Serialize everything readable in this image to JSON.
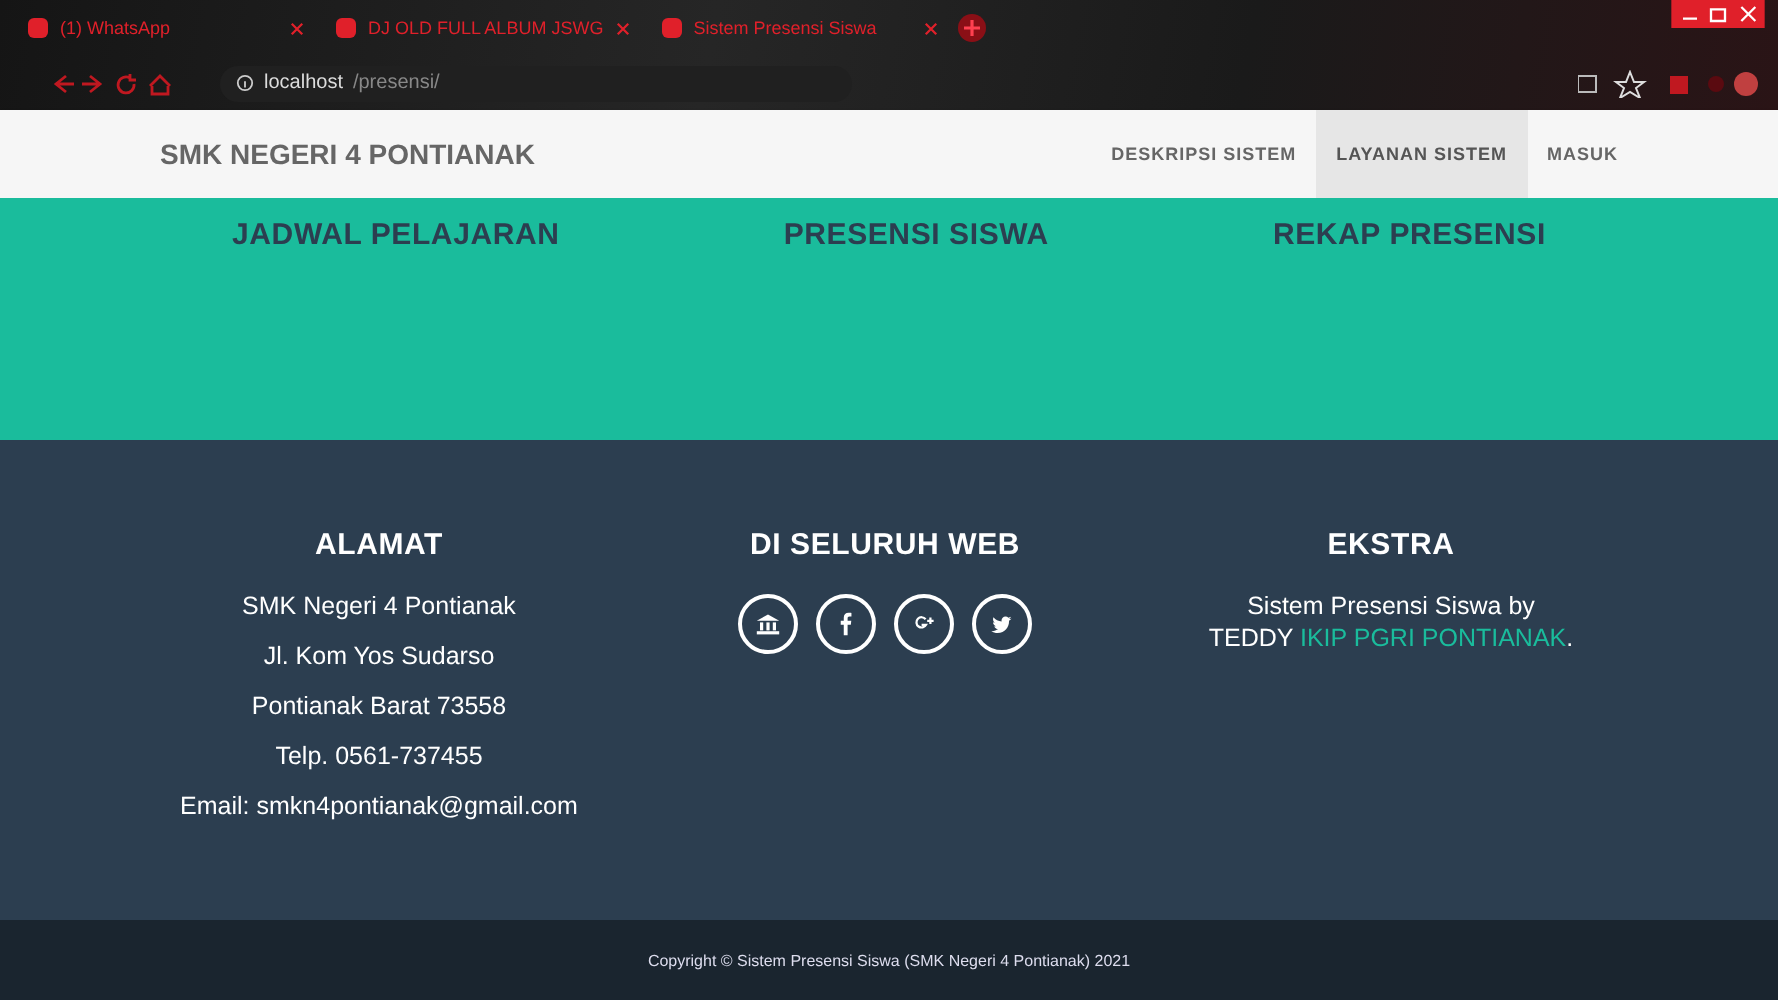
{
  "browser": {
    "tabs": [
      {
        "title": "(1) WhatsApp"
      },
      {
        "title": "DJ OLD FULL ALBUM JSWG"
      },
      {
        "title": "Sistem Presensi Siswa"
      }
    ],
    "address": {
      "host": "localhost",
      "path": "/presensi/"
    }
  },
  "navbar": {
    "brand": "SMK NEGERI 4 PONTIANAK",
    "items": [
      {
        "label": "DESKRIPSI SISTEM",
        "selected": false
      },
      {
        "label": "LAYANAN SISTEM",
        "selected": true
      },
      {
        "label": "MASUK",
        "selected": false
      }
    ]
  },
  "services": [
    "JADWAL PELAJARAN",
    "PRESENSI SISWA",
    "REKAP PRESENSI"
  ],
  "footer": {
    "address": {
      "title": "ALAMAT",
      "lines": [
        "SMK Negeri 4 Pontianak",
        "Jl. Kom Yos Sudarso",
        "Pontianak Barat 73558",
        "Telp. 0561-737455",
        "Email: smkn4pontianak@gmail.com"
      ]
    },
    "web": {
      "title": "DI SELURUH WEB",
      "links": [
        {
          "kind": "bank"
        },
        {
          "kind": "facebook"
        },
        {
          "kind": "google-plus"
        },
        {
          "kind": "twitter"
        }
      ]
    },
    "extra": {
      "title": "EKSTRA",
      "text": "Sistem Presensi Siswa by",
      "author": "TEDDY",
      "link": "IKIP PGRI PONTIANAK",
      "end": "."
    }
  },
  "copyright": "Copyright © Sistem Presensi Siswa (SMK Negeri 4 Pontianak) 2021"
}
